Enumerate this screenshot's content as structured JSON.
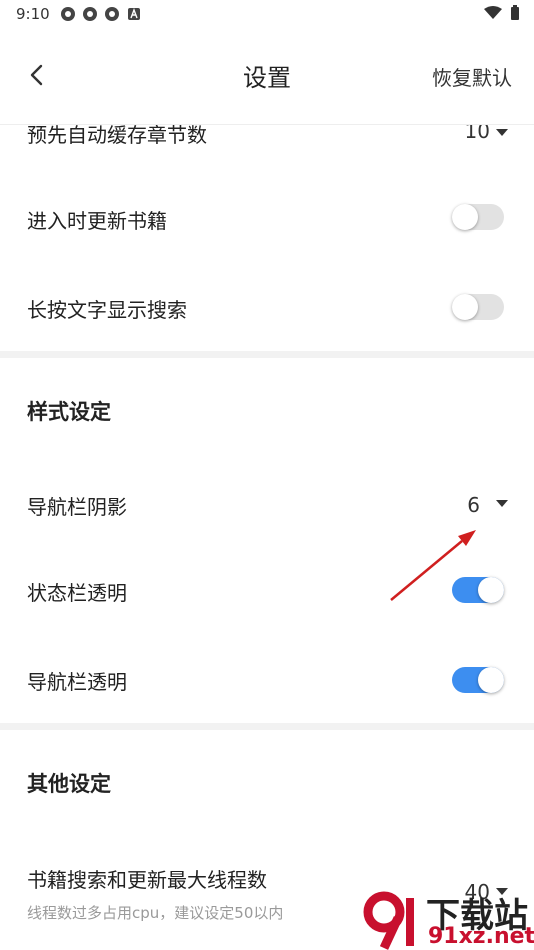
{
  "status_bar": {
    "time": "9:10"
  },
  "header": {
    "title": "设置",
    "reset_label": "恢复默认"
  },
  "rows": {
    "precache": {
      "label": "预先自动缓存章节数",
      "value": "10"
    },
    "update_on_enter": {
      "label": "进入时更新书籍",
      "toggle": false
    },
    "long_press_search": {
      "label": "长按文字显示搜索",
      "toggle": false
    }
  },
  "style_section": {
    "title": "样式设定",
    "nav_shadow": {
      "label": "导航栏阴影",
      "value": "6"
    },
    "status_transparent": {
      "label": "状态栏透明",
      "toggle": true
    },
    "nav_transparent": {
      "label": "导航栏透明",
      "toggle": true
    }
  },
  "other_section": {
    "title": "其他设定",
    "thread_count": {
      "label": "书籍搜索和更新最大线程数",
      "hint": "线程数过多占用cpu，建议设定50以内",
      "value": "40"
    }
  },
  "watermark": {
    "line1": "下载站",
    "line2": "91xz.net"
  },
  "colors": {
    "accent": "#3d8ef0",
    "toggle_off": "#e2e2e2",
    "arrow": "#d01f1f"
  }
}
